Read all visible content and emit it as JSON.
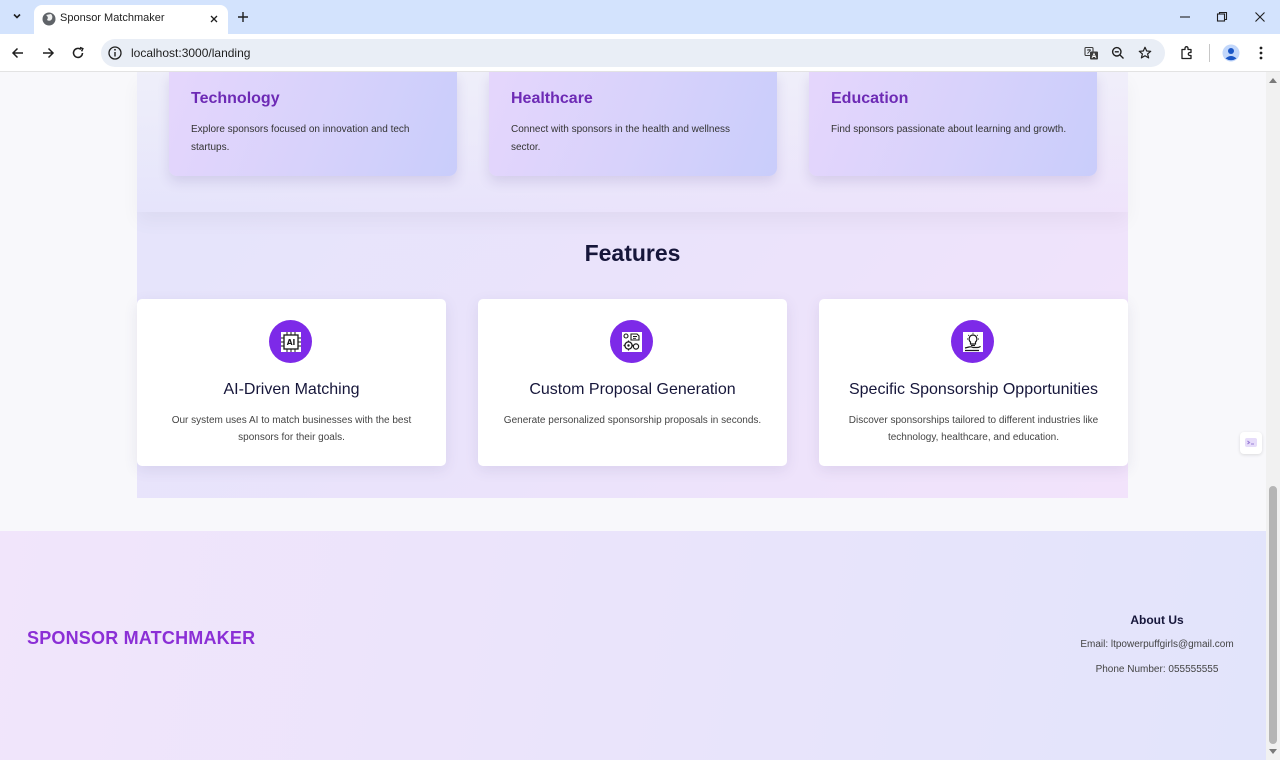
{
  "browser": {
    "tab_title": "Sponsor Matchmaker",
    "url": "localhost:3000/landing"
  },
  "industries": [
    {
      "title": "Technology",
      "description": "Explore sponsors focused on innovation and tech startups."
    },
    {
      "title": "Healthcare",
      "description": "Connect with sponsors in the health and wellness sector."
    },
    {
      "title": "Education",
      "description": "Find sponsors passionate about learning and growth."
    }
  ],
  "features": {
    "heading": "Features",
    "items": [
      {
        "icon": "ai-chip-icon",
        "icon_text": "AI",
        "title": "AI-Driven Matching",
        "description": "Our system uses AI to match businesses with the best sponsors for their goals."
      },
      {
        "icon": "proposal-gears-icon",
        "title": "Custom Proposal Generation",
        "description": "Generate personalized sponsorship proposals in seconds."
      },
      {
        "icon": "lightbulb-hand-icon",
        "title": "Specific Sponsorship Opportunities",
        "description": "Discover sponsorships tailored to different industries like technology, healthcare, and education."
      }
    ]
  },
  "footer": {
    "brand": "SPONSOR MATCHMAKER",
    "about_title": "About Us",
    "email": "Email: ltpowerpuffgirls@gmail.com",
    "phone": "Phone Number: 055555555"
  },
  "colors": {
    "accent": "#7d2ae8",
    "brand": "#8b2fd6",
    "industry_title": "#6d2ab5",
    "heading": "#16163a"
  }
}
